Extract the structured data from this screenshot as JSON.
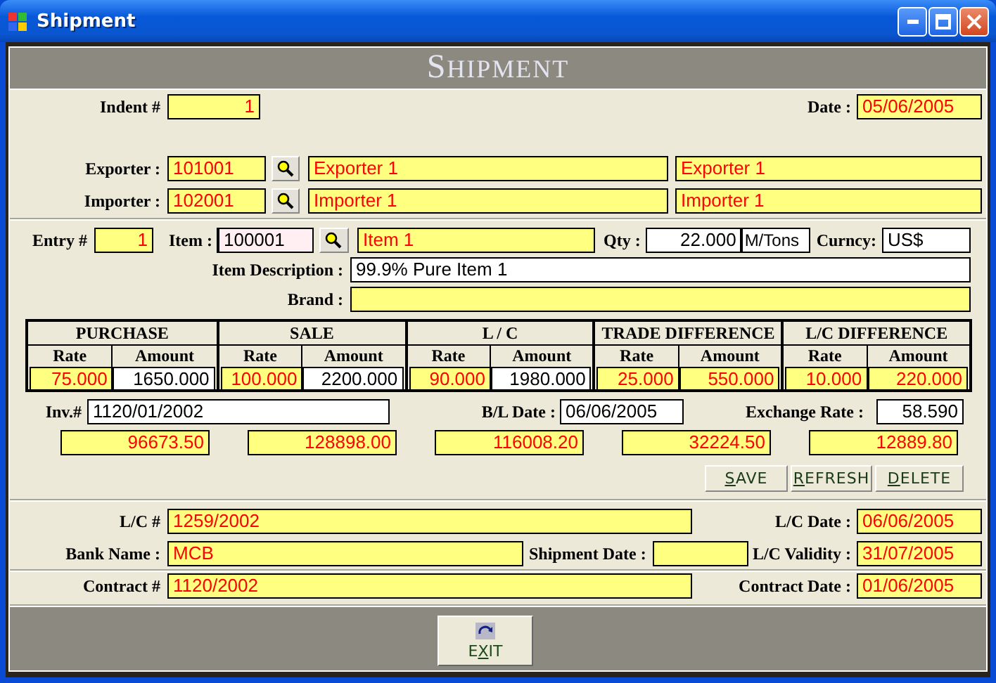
{
  "window": {
    "title": "Shipment"
  },
  "banner": {
    "title": "SHIPMENT"
  },
  "indent": {
    "label": "Indent #",
    "value": "1",
    "kind": "computed"
  },
  "date": {
    "label": "Date :",
    "value": "05/06/2005",
    "kind": "computed"
  },
  "exporter": {
    "label": "Exporter :",
    "code": {
      "value": "101001",
      "kind": "computed"
    },
    "name": {
      "value": "Exporter 1",
      "kind": "computed"
    },
    "name_2": {
      "value": "Exporter 1",
      "kind": "computed"
    }
  },
  "importer": {
    "label": "Importer :",
    "code": {
      "value": "102001",
      "kind": "computed"
    },
    "name": {
      "value": "Importer 1",
      "kind": "computed"
    },
    "name_2": {
      "value": "Importer 1",
      "kind": "computed"
    }
  },
  "entry": {
    "label": "Entry #",
    "value": "1",
    "kind": "computed"
  },
  "item": {
    "label": "Item :",
    "code": {
      "value": "100001",
      "kind": "focused"
    },
    "name": {
      "value": "Item 1",
      "kind": "computed"
    }
  },
  "qty": {
    "label": "Qty :",
    "value": "22.000",
    "kind": "entry"
  },
  "unit": {
    "value": "M/Tons",
    "kind": "entry"
  },
  "currency": {
    "label": "Curncy:",
    "value": "US$",
    "kind": "entry"
  },
  "item_description": {
    "label": "Item Description :",
    "value": "99.9% Pure Item 1",
    "kind": "entry"
  },
  "brand": {
    "label": "Brand :",
    "kind": "computed"
  },
  "grid": [
    {
      "title": "PURCHASE",
      "rate": {
        "label": "Rate",
        "value": "75.000",
        "kind": "computed"
      },
      "amount": {
        "label": "Amount",
        "value": "1650.000",
        "kind": "entry"
      }
    },
    {
      "title": "SALE",
      "rate": {
        "label": "Rate",
        "value": "100.000",
        "kind": "computed"
      },
      "amount": {
        "label": "Amount",
        "value": "2200.000",
        "kind": "entry"
      }
    },
    {
      "title": "L / C",
      "rate": {
        "label": "Rate",
        "value": "90.000",
        "kind": "computed"
      },
      "amount": {
        "label": "Amount",
        "value": "1980.000",
        "kind": "entry"
      }
    },
    {
      "title": "TRADE DIFFERENCE",
      "rate": {
        "label": "Rate",
        "value": "25.000",
        "kind": "computed"
      },
      "amount": {
        "label": "Amount",
        "value": "550.000",
        "kind": "computed"
      }
    },
    {
      "title": "L/C DIFFERENCE",
      "rate": {
        "label": "Rate",
        "value": "10.000",
        "kind": "computed"
      },
      "amount": {
        "label": "Amount",
        "value": "220.000",
        "kind": "computed"
      }
    }
  ],
  "invoice": {
    "label": "Inv.#",
    "value": "1120/01/2002",
    "kind": "entry"
  },
  "bl_date": {
    "label": "B/L Date :",
    "value": "06/06/2005",
    "kind": "entry"
  },
  "exchange_rate": {
    "label": "Exchange Rate :",
    "value": "58.590",
    "kind": "entry"
  },
  "totals": [
    {
      "value": "96673.50",
      "kind": "computed"
    },
    {
      "value": "128898.00",
      "kind": "computed"
    },
    {
      "value": "116008.20",
      "kind": "computed"
    },
    {
      "value": "32224.50",
      "kind": "computed"
    },
    {
      "value": "12889.80",
      "kind": "computed"
    }
  ],
  "actions": [
    {
      "key": "S",
      "rest": "AVE"
    },
    {
      "key": "R",
      "rest": "EFRESH"
    },
    {
      "key": "D",
      "rest": "ELETE"
    }
  ],
  "lc": {
    "label": "L/C #",
    "value": "1259/2002",
    "kind": "computed"
  },
  "lc_date": {
    "label": "L/C Date :",
    "value": "06/06/2005",
    "kind": "computed"
  },
  "bank_name": {
    "label": "Bank Name :",
    "value": "MCB",
    "kind": "computed"
  },
  "shipment_date": {
    "label": "Shipment Date :",
    "kind": "computed"
  },
  "lc_validity": {
    "label": "L/C Validity :",
    "value": "31/07/2005",
    "kind": "computed"
  },
  "contract": {
    "label": "Contract #",
    "value": "1120/2002",
    "kind": "computed"
  },
  "contract_date": {
    "label": "Contract Date :",
    "value": "01/06/2005",
    "kind": "computed"
  },
  "exit": {
    "head": "E",
    "key": "X",
    "rest": "IT"
  }
}
